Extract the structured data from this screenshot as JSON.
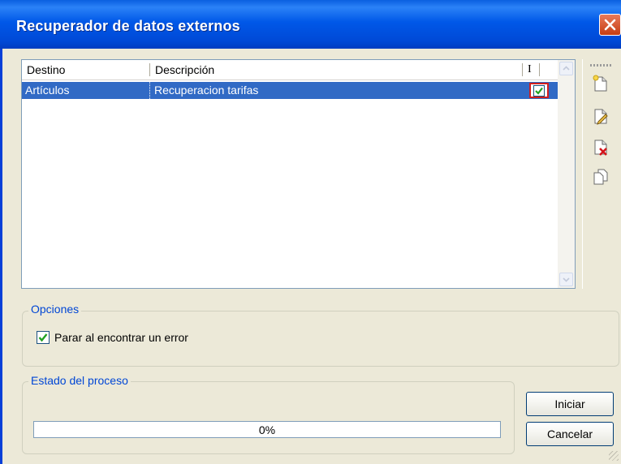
{
  "window": {
    "title": "Recuperador de datos externos"
  },
  "table": {
    "columns": {
      "destino": "Destino",
      "descripcion": "Descripción",
      "i": "I"
    },
    "rows": [
      {
        "destino": "Artículos",
        "descripcion": "Recuperacion tarifas",
        "checked": true,
        "selected": true
      }
    ]
  },
  "toolbar": {
    "buttons": [
      "new-document-icon",
      "edit-document-icon",
      "delete-document-icon",
      "copy-document-icon"
    ]
  },
  "options": {
    "legend": "Opciones",
    "stop_on_error": {
      "label": "Parar al encontrar un error",
      "checked": true
    }
  },
  "process": {
    "legend": "Estado del proceso",
    "progress_text": "0%",
    "progress_value": 0
  },
  "buttons": {
    "start": "Iniciar",
    "cancel": "Cancelar"
  },
  "colors": {
    "title_bar": "#0058e8",
    "selection": "#316ac5",
    "legend_text": "#0046d5",
    "close": "#c53d13"
  }
}
